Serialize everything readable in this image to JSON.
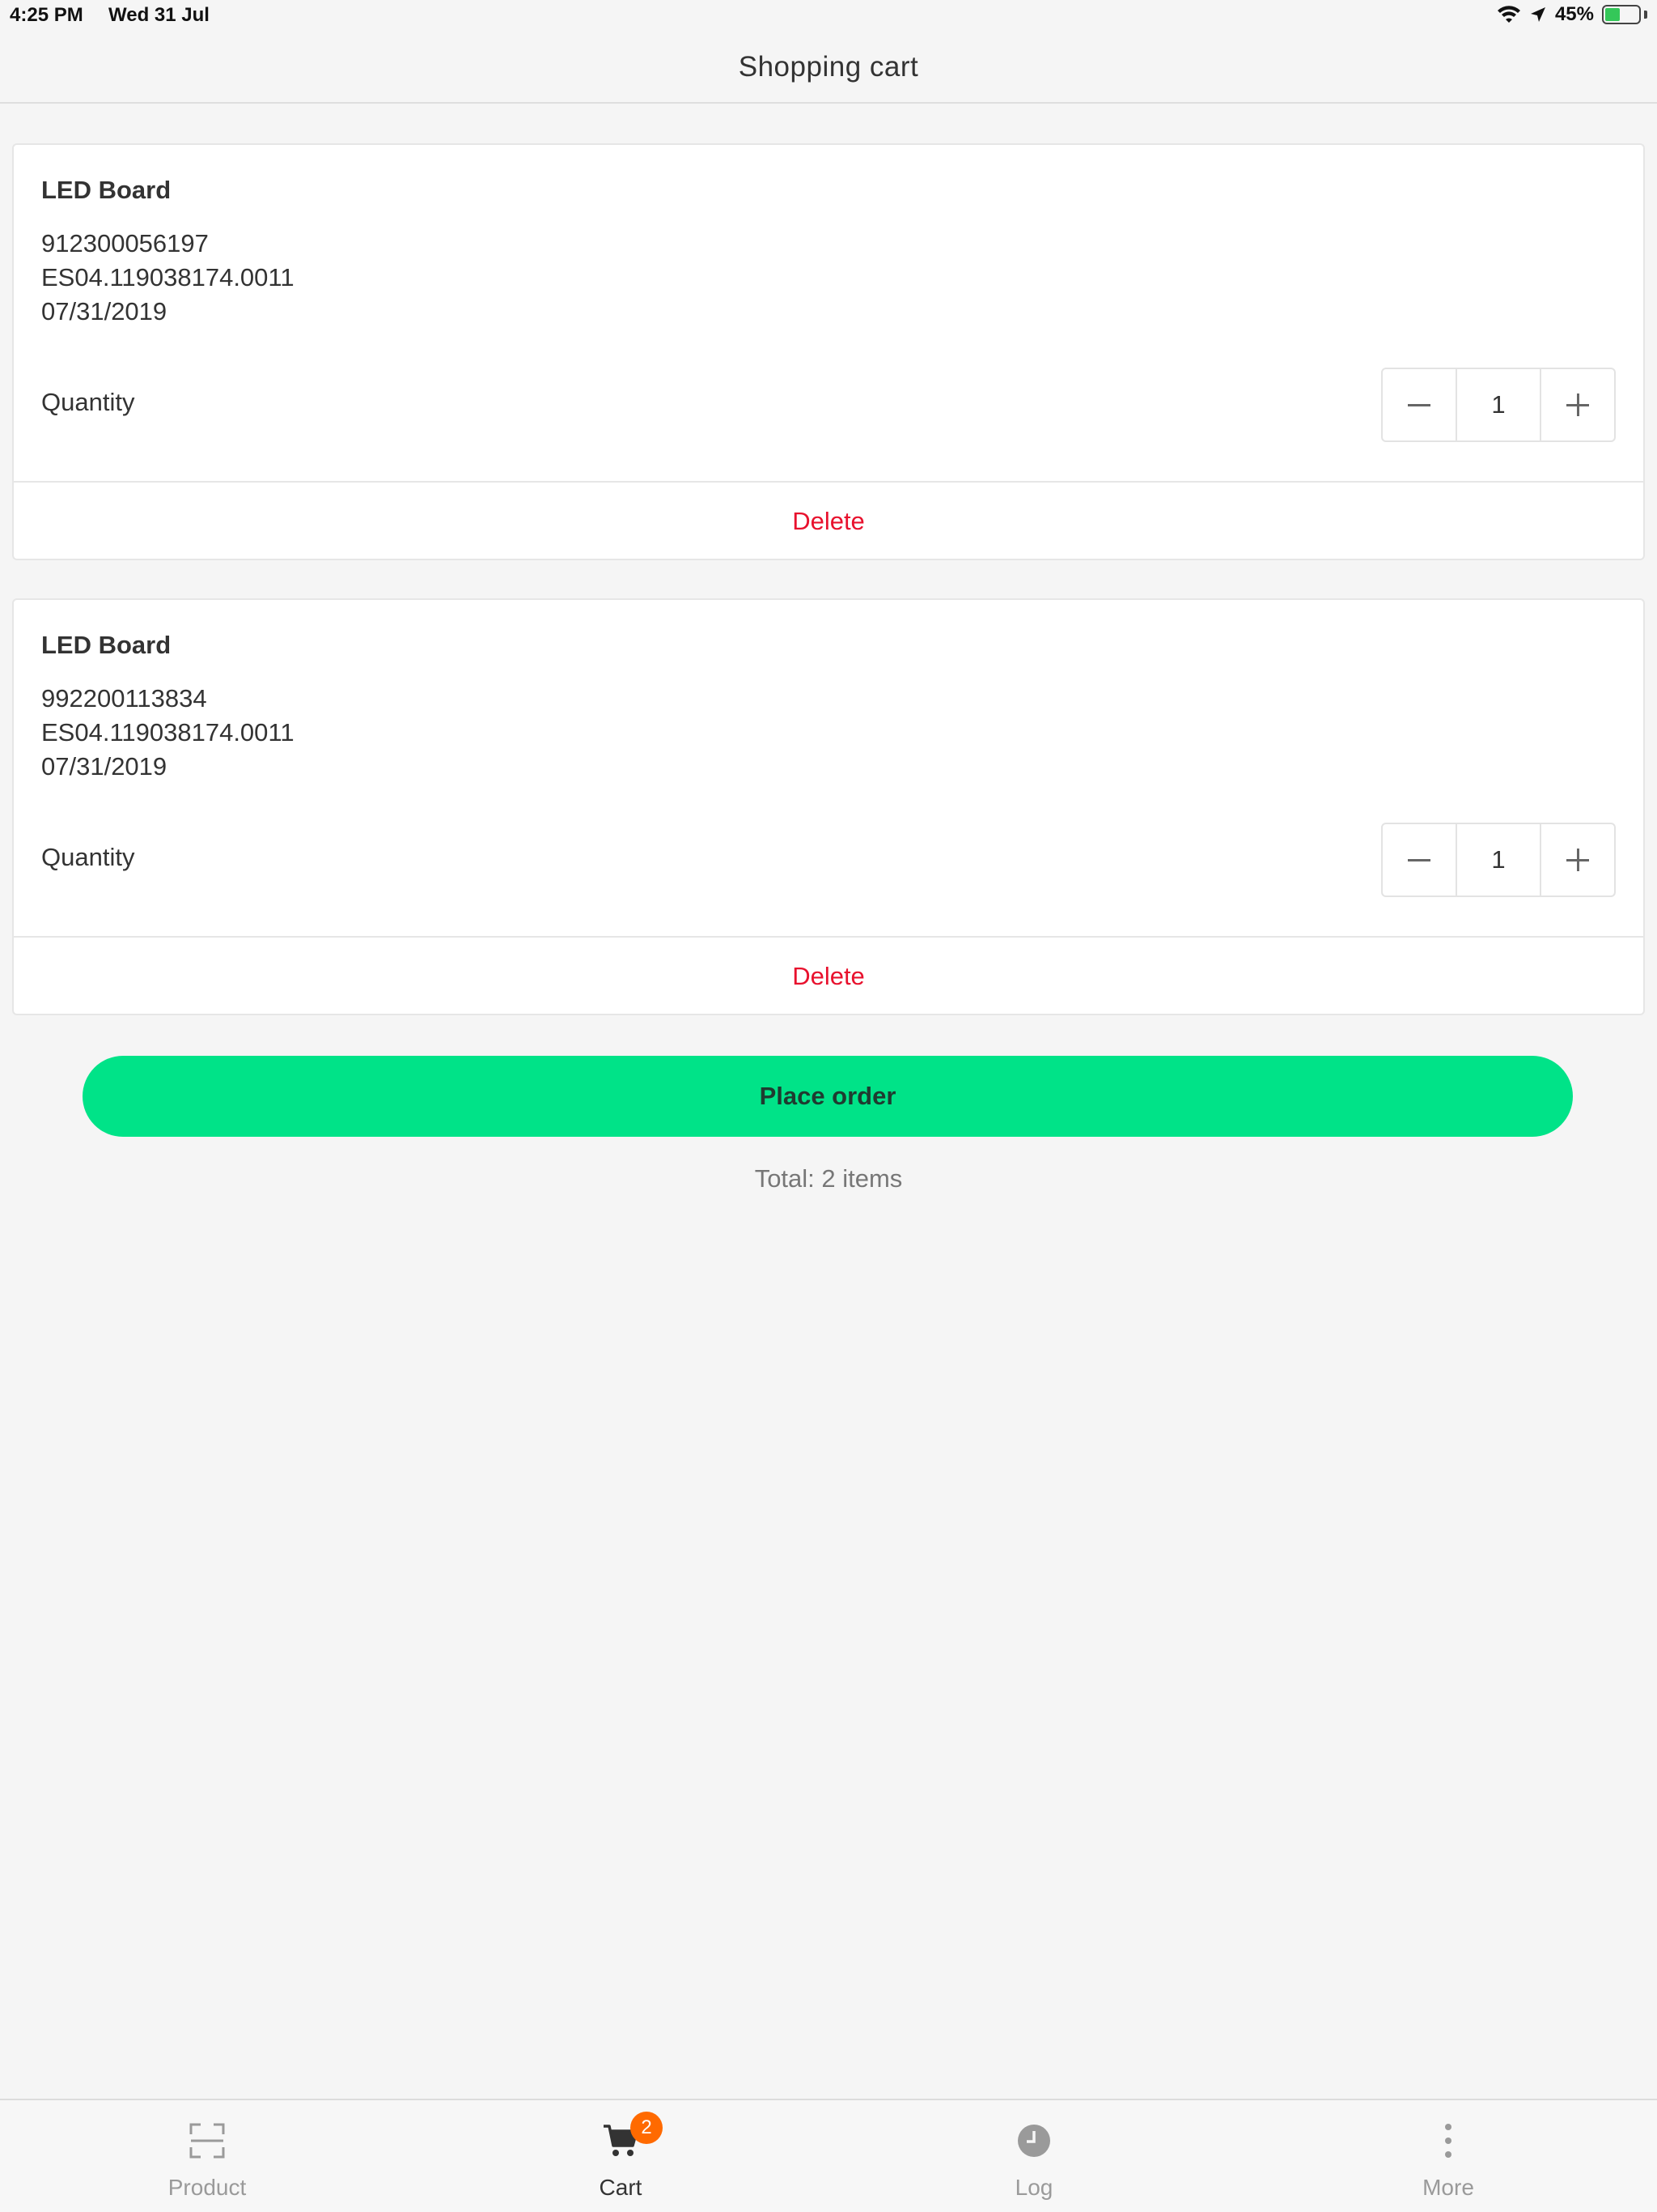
{
  "status_bar": {
    "time": "4:25 PM",
    "date": "Wed 31 Jul",
    "battery": "45%",
    "battery_level": 0.45,
    "icons": [
      "wifi-icon",
      "location-arrow-icon",
      "battery-charging-icon"
    ]
  },
  "header": {
    "title": "Shopping cart"
  },
  "cart_items": [
    {
      "name": "LED Board",
      "serial": "912300056197",
      "code": "ES04.119038174.0011",
      "date": "07/31/2019",
      "quantity_label": "Quantity",
      "quantity": "1",
      "delete_label": "Delete"
    },
    {
      "name": "LED Board",
      "serial": "992200113834",
      "code": "ES04.119038174.0011",
      "date": "07/31/2019",
      "quantity_label": "Quantity",
      "quantity": "1",
      "delete_label": "Delete"
    }
  ],
  "actions": {
    "place_order_label": "Place order",
    "total_text": "Total: 2 items"
  },
  "tab_bar": {
    "tabs": [
      {
        "label": "Product",
        "icon": "scan-frame-icon",
        "active": false
      },
      {
        "label": "Cart",
        "icon": "cart-icon",
        "active": true,
        "badge": "2"
      },
      {
        "label": "Log",
        "icon": "clock-icon",
        "active": false
      },
      {
        "label": "More",
        "icon": "more-vertical-icon",
        "active": false
      }
    ]
  },
  "colors": {
    "accent_green": "#00e388",
    "delete_red": "#e8112d",
    "badge_orange": "#ff6a00",
    "background": "#f5f5f5"
  }
}
